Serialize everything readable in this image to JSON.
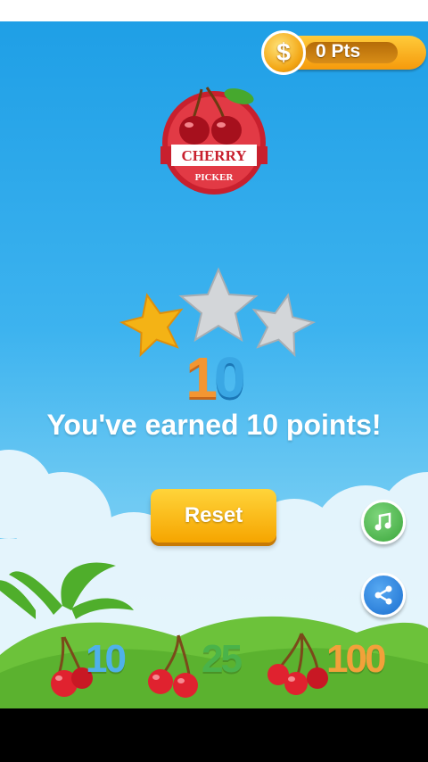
{
  "points": {
    "value": "0 Pts",
    "coin_icon": "dollar-coin-icon"
  },
  "logo": {
    "line1": "CHERRY",
    "line2": "PICKER"
  },
  "result": {
    "score_tens": "1",
    "score_ones": "0",
    "message": "You've earned 10 points!",
    "stars_earned": 1,
    "stars_total": 3
  },
  "buttons": {
    "reset_label": "Reset",
    "music_icon": "music-note-icon",
    "share_icon": "share-icon"
  },
  "legend": {
    "items": [
      "10",
      "25",
      "100"
    ]
  },
  "colors": {
    "sky": "#3db3ef",
    "accent": "#f6a500",
    "cherry": "#e0222f",
    "grass": "#6cc23a"
  }
}
